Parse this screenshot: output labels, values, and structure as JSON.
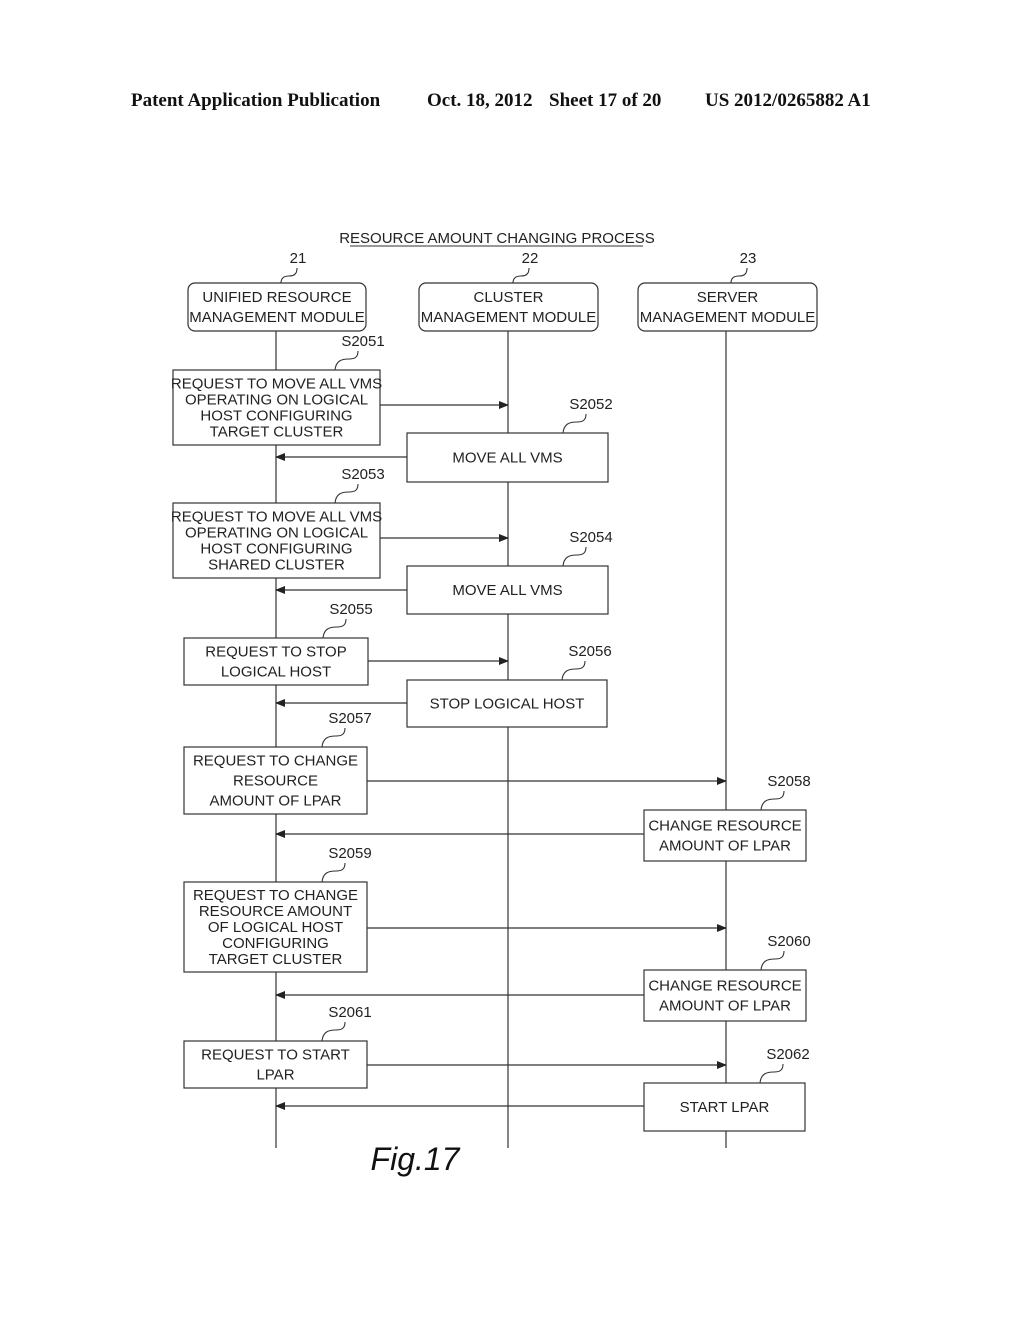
{
  "header": {
    "publication": "Patent Application Publication",
    "date": "Oct. 18, 2012",
    "sheet": "Sheet 17 of 20",
    "number": "US 2012/0265882 A1"
  },
  "diagram": {
    "title": "RESOURCE AMOUNT CHANGING PROCESS",
    "figure_label": "Fig.17",
    "modules": [
      {
        "id": "21",
        "lines": [
          "UNIFIED RESOURCE",
          "MANAGEMENT MODULE"
        ]
      },
      {
        "id": "22",
        "lines": [
          "CLUSTER",
          "MANAGEMENT MODULE"
        ]
      },
      {
        "id": "23",
        "lines": [
          "SERVER",
          "MANAGEMENT MODULE"
        ]
      }
    ],
    "steps": [
      {
        "id": "S2051",
        "lane": 0,
        "lines": [
          "REQUEST TO MOVE ALL VMS",
          "OPERATING ON LOGICAL",
          "HOST CONFIGURING",
          "TARGET CLUSTER"
        ]
      },
      {
        "id": "S2052",
        "lane": 1,
        "lines": [
          "MOVE ALL VMS"
        ]
      },
      {
        "id": "S2053",
        "lane": 0,
        "lines": [
          "REQUEST TO MOVE ALL VMS",
          "OPERATING ON LOGICAL",
          "HOST CONFIGURING",
          "SHARED CLUSTER"
        ]
      },
      {
        "id": "S2054",
        "lane": 1,
        "lines": [
          "MOVE ALL VMS"
        ]
      },
      {
        "id": "S2055",
        "lane": 0,
        "lines": [
          "REQUEST TO STOP",
          "LOGICAL HOST"
        ]
      },
      {
        "id": "S2056",
        "lane": 1,
        "lines": [
          "STOP LOGICAL HOST"
        ]
      },
      {
        "id": "S2057",
        "lane": 0,
        "lines": [
          "REQUEST TO CHANGE",
          "RESOURCE",
          "AMOUNT OF LPAR"
        ]
      },
      {
        "id": "S2058",
        "lane": 2,
        "lines": [
          "CHANGE RESOURCE",
          "AMOUNT OF LPAR"
        ]
      },
      {
        "id": "S2059",
        "lane": 0,
        "lines": [
          "REQUEST TO CHANGE",
          "RESOURCE AMOUNT",
          "OF LOGICAL HOST",
          "CONFIGURING",
          "TARGET CLUSTER"
        ]
      },
      {
        "id": "S2060",
        "lane": 2,
        "lines": [
          "CHANGE RESOURCE",
          "AMOUNT OF LPAR"
        ]
      },
      {
        "id": "S2061",
        "lane": 0,
        "lines": [
          "REQUEST TO START",
          "LPAR"
        ]
      },
      {
        "id": "S2062",
        "lane": 2,
        "lines": [
          "START LPAR"
        ]
      }
    ]
  }
}
